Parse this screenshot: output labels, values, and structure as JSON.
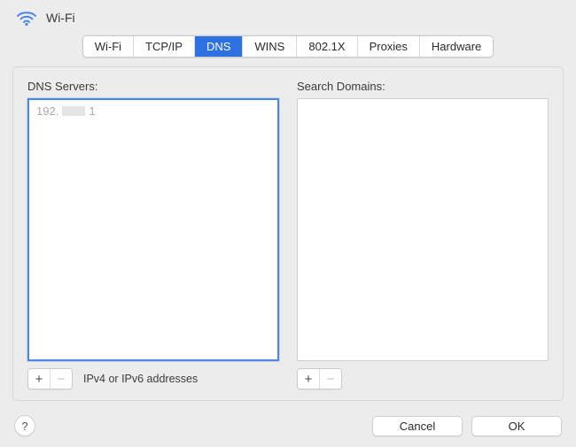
{
  "header": {
    "title": "Wi-Fi"
  },
  "tabs": {
    "wifi": "Wi-Fi",
    "tcpip": "TCP/IP",
    "dns": "DNS",
    "wins": "WINS",
    "8021x": "802.1X",
    "proxies": "Proxies",
    "hardware": "Hardware",
    "active": "dns"
  },
  "dns_servers": {
    "label": "DNS Servers:",
    "entry_prefix": "192.",
    "entry_suffix": "1",
    "hint": "IPv4 or IPv6 addresses"
  },
  "search_domains": {
    "label": "Search Domains:"
  },
  "buttons": {
    "plus": "+",
    "minus": "−",
    "help": "?",
    "cancel": "Cancel",
    "ok": "OK"
  },
  "colors": {
    "accent": "#2f71e1",
    "focus": "#4a87e8"
  }
}
